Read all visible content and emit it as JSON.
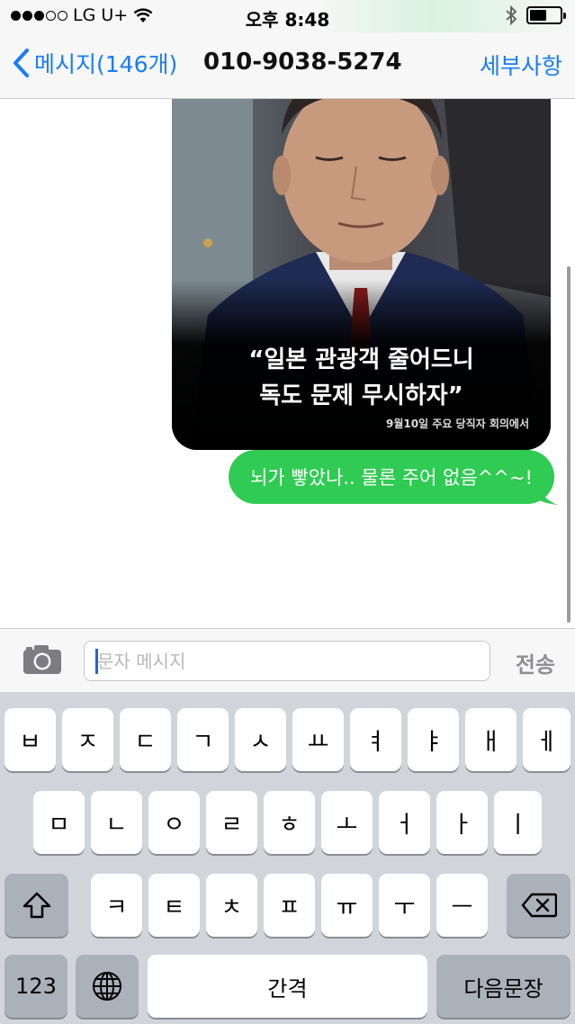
{
  "status_bar": {
    "carrier": "LG U+",
    "time": "오후 8:48",
    "battery_level": 0.55
  },
  "nav": {
    "back_label": "메시지(146개)",
    "title": "010-9038-5274",
    "detail_label": "세부사항"
  },
  "conversation": {
    "image_message": {
      "caption_line1": "“일본 관광객 줄어드니",
      "caption_line2": "독도 문제 무시하자”",
      "source_note": "9월10일 주요 당직자 회의에서"
    },
    "sent_message": "뇌가 빻았나.. 물론 주어 없음^^~!"
  },
  "input": {
    "placeholder": "문자 메시지",
    "send_label": "전송"
  },
  "keyboard": {
    "row1": [
      "ㅂ",
      "ㅈ",
      "ㄷ",
      "ㄱ",
      "ㅅ",
      "ㅛ",
      "ㅕ",
      "ㅑ",
      "ㅐ",
      "ㅔ"
    ],
    "row2": [
      "ㅁ",
      "ㄴ",
      "ㅇ",
      "ㄹ",
      "ㅎ",
      "ㅗ",
      "ㅓ",
      "ㅏ",
      "ㅣ"
    ],
    "row3": [
      "ㅋ",
      "ㅌ",
      "ㅊ",
      "ㅍ",
      "ㅠ",
      "ㅜ",
      "ㅡ"
    ],
    "numbers_label": "123",
    "space_label": "간격",
    "return_label": "다음문장",
    "icons": [
      "shift-icon",
      "delete-icon",
      "globe-icon"
    ]
  },
  "colors": {
    "accent": "#1a7cf4",
    "sent_bubble": "#2fcb52",
    "keyboard_bg": "#d1d5db"
  }
}
